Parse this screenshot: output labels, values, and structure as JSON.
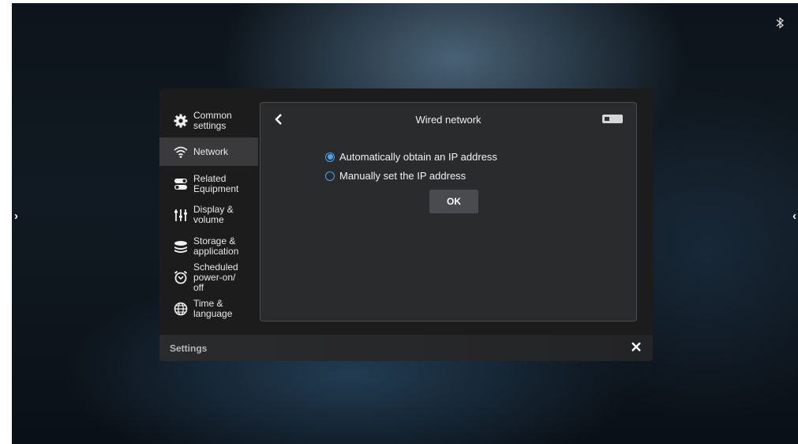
{
  "edges": {
    "left_arrow": "›",
    "right_arrow": "‹"
  },
  "status_bar": {
    "bluetooth_icon": "bluetooth-icon"
  },
  "sidebar": {
    "items": [
      {
        "label": "Common\nsettings",
        "icon": "gear-icon",
        "active": false
      },
      {
        "label": "Network",
        "icon": "wifi-icon",
        "active": true
      },
      {
        "label": "Related\nEquipment",
        "icon": "toggle-switch-icon",
        "active": false
      },
      {
        "label": "Display &\nvolume",
        "icon": "sliders-icon",
        "active": false
      },
      {
        "label": "Storage &\napplication",
        "icon": "storage-icon",
        "active": false
      },
      {
        "label": "Scheduled\npower-on/\noff",
        "icon": "alarm-clock-icon",
        "active": false
      },
      {
        "label": "Time &\nlanguage",
        "icon": "globe-icon",
        "active": false
      }
    ]
  },
  "content": {
    "title": "Wired network",
    "toggle_on": false,
    "options": [
      {
        "label": "Automatically obtain an IP address",
        "selected": true
      },
      {
        "label": "Manually set the IP address",
        "selected": false
      }
    ],
    "ok_label": "OK"
  },
  "footer": {
    "title": "Settings"
  },
  "colors": {
    "accent": "#4aa3f0",
    "panel": "#1c1c1d",
    "active_item": "#3a3a3c"
  }
}
